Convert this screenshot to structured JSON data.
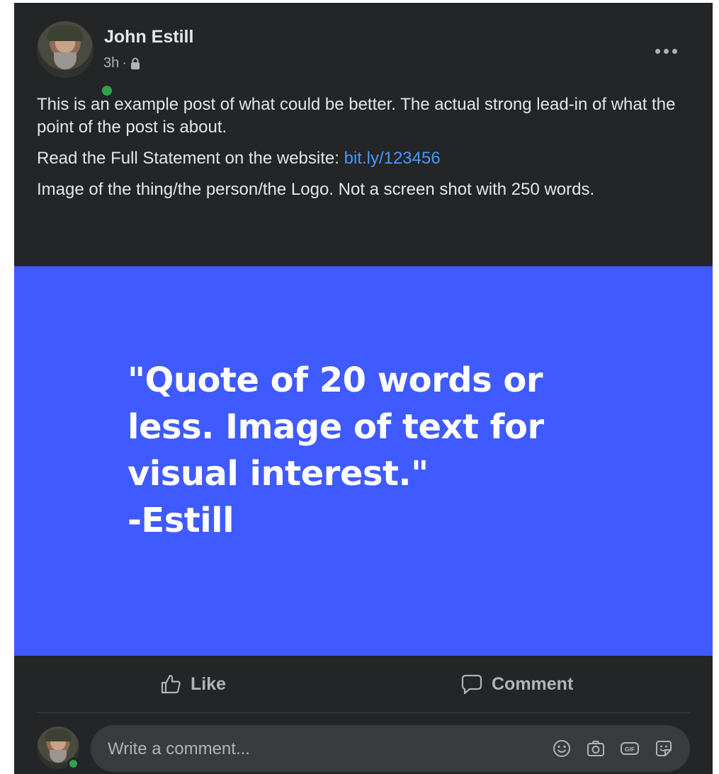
{
  "post": {
    "author": "John Estill",
    "time": "3h",
    "separator": "·",
    "privacy_icon": "lock-icon",
    "more_icon": "more-options-icon",
    "paragraphs": [
      {
        "text": "This is an example post of what could be better. The actual strong lead-in of what the point of the post is about."
      },
      {
        "text": "Read the Full Statement on the website: ",
        "link": "bit.ly/123456"
      },
      {
        "text": "Image of the thing/the person/the Logo. Not a screen shot with 250 words."
      }
    ],
    "image": {
      "background": "#3f5aff",
      "quote_lines": [
        "\"Quote of 20 words or",
        "less. Image of text for",
        "visual interest.\"",
        "-Estill"
      ]
    }
  },
  "actions": {
    "like_label": "Like",
    "comment_label": "Comment"
  },
  "composer": {
    "placeholder": "Write a comment...",
    "icons": [
      "emoji-icon",
      "camera-icon",
      "gif-icon",
      "sticker-icon"
    ]
  },
  "colors": {
    "card_bg": "#242526",
    "text": "#e4e6eb",
    "secondary": "#b0b3b8",
    "link": "#4599ff",
    "online": "#31a24c"
  }
}
